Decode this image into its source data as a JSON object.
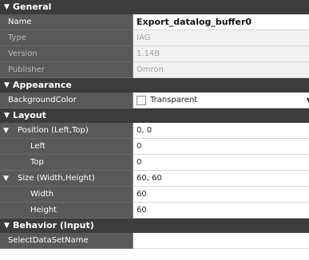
{
  "sections": {
    "general": "General",
    "appearance": "Appearance",
    "layout": "Layout",
    "behavior": "Behavior (Input)"
  },
  "arrows": {
    "expanded": "▼"
  },
  "general": {
    "name": {
      "label": "Name",
      "value": "Export_datalog_buffer0"
    },
    "type": {
      "label": "Type",
      "value": "IAG"
    },
    "version": {
      "label": "Version",
      "value": "1.14B"
    },
    "publisher": {
      "label": "Publisher",
      "value": "Omron"
    }
  },
  "appearance": {
    "background_color": {
      "label": "BackgroundColor",
      "value": "Transparent"
    }
  },
  "layout": {
    "position": {
      "label": "Position (Left,Top)",
      "value": "0, 0"
    },
    "left": {
      "label": "Left",
      "value": "0"
    },
    "top": {
      "label": "Top",
      "value": "0"
    },
    "size": {
      "label": "Size (Width,Height)",
      "value": "60, 60"
    },
    "width": {
      "label": "Width",
      "value": "60"
    },
    "height": {
      "label": "Height",
      "value": "60"
    }
  },
  "behavior": {
    "select_dataset_name": {
      "label": "SelectDataSetName",
      "value": ""
    }
  }
}
